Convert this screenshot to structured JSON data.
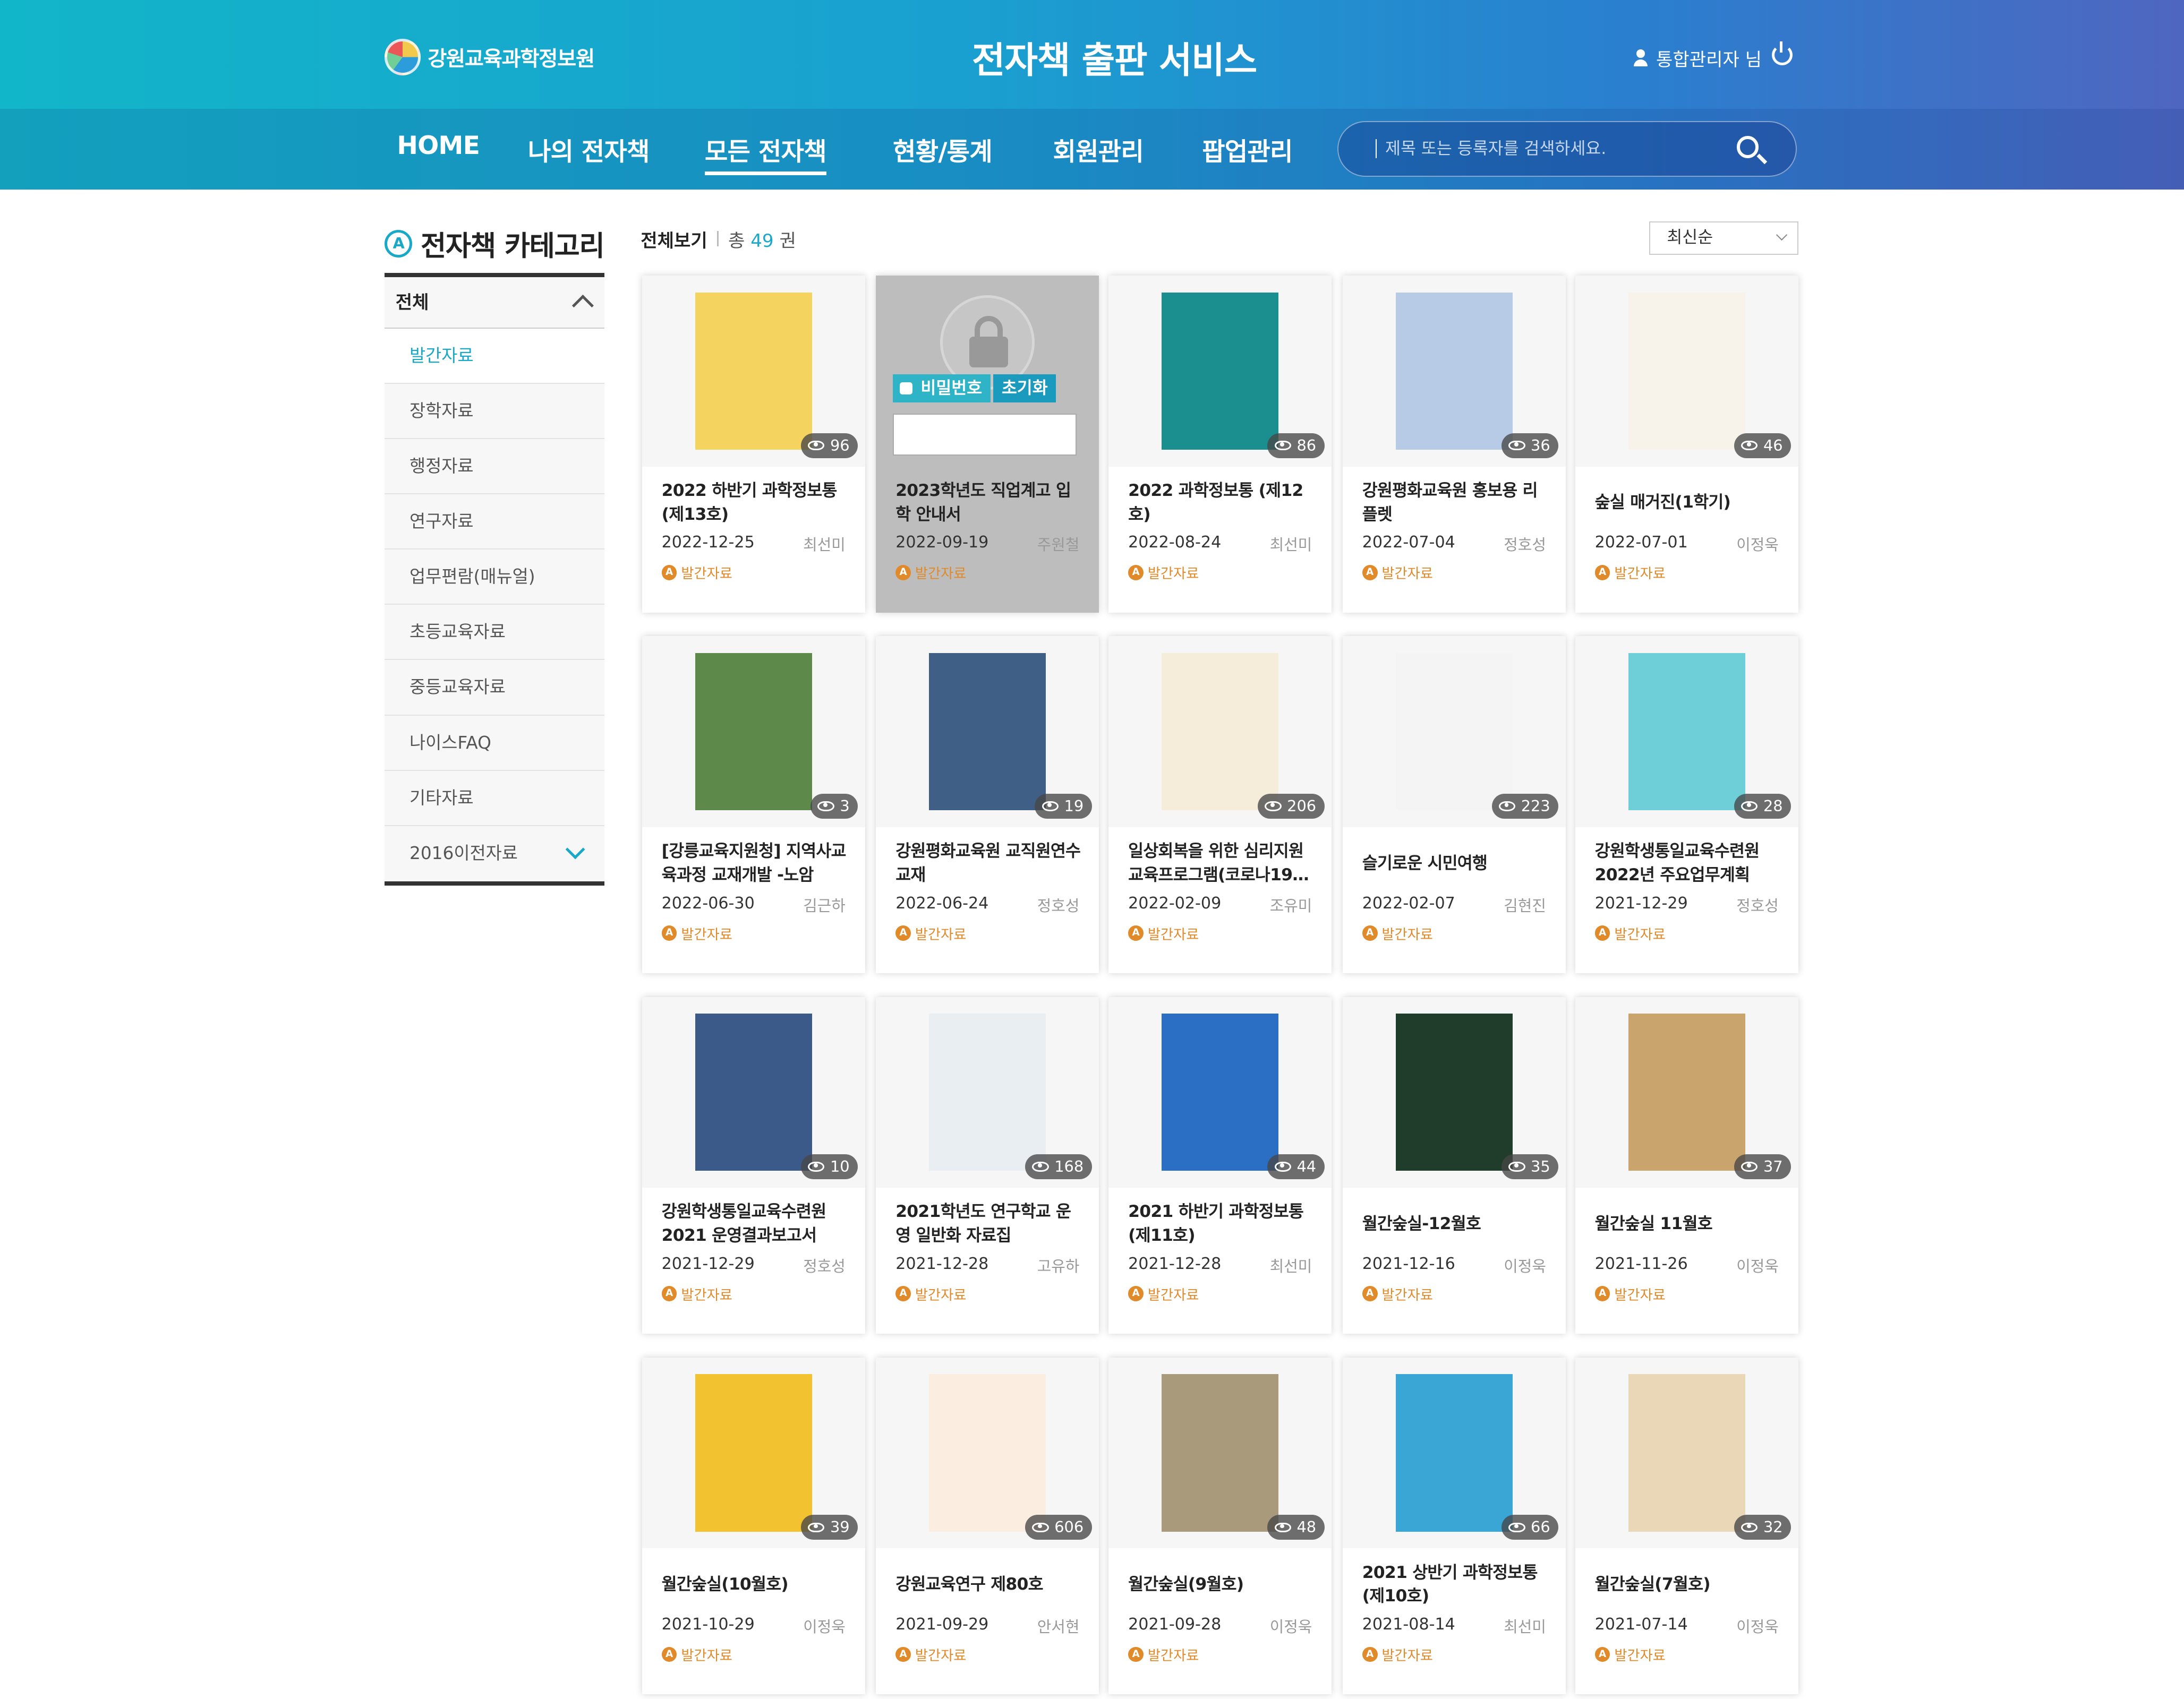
{
  "header": {
    "org_name": "강원교육과학정보원",
    "service_title": "전자책 출판 서비스",
    "user_label": "통합관리자 님"
  },
  "nav": {
    "items": [
      "HOME",
      "나의 전자책",
      "모든 전자책",
      "현황/통계",
      "회원관리",
      "팝업관리"
    ],
    "active": "모든 전자책"
  },
  "search": {
    "placeholder": "제목 또는 등록자를 검색하세요."
  },
  "sidebar": {
    "title": "전자책 카테고리",
    "badge": "A",
    "all_label": "전체",
    "items": [
      "발간자료",
      "장학자료",
      "행정자료",
      "연구자료",
      "업무편람(매뉴얼)",
      "초등교육자료",
      "중등교육자료",
      "나이스FAQ",
      "기타자료",
      "2016이전자료"
    ]
  },
  "list_header": {
    "view_all": "전체보기",
    "total_prefix": "총",
    "total_count": "49",
    "total_suffix": "권"
  },
  "sort": {
    "selected": "최신순"
  },
  "lock_panel": {
    "password_label": "비밀번호",
    "reset_label": "초기화"
  },
  "books": [
    {
      "title": "2022 하반기 과학정보통 (제13호)",
      "date": "2022-12-25",
      "author": "최선미",
      "category": "발간자료",
      "views": "96",
      "cover": "#f4d35e"
    },
    {
      "title": "2023학년도 직업계고 입학 안내서",
      "date": "2022-09-19",
      "author": "주원철",
      "category": "발간자료",
      "views": "",
      "locked": true
    },
    {
      "title": "2022 과학정보통 (제12호)",
      "date": "2022-08-24",
      "author": "최선미",
      "category": "발간자료",
      "views": "86",
      "cover": "#1b8e8f"
    },
    {
      "title": "강원평화교육원 홍보용 리플렛",
      "date": "2022-07-04",
      "author": "정호성",
      "category": "발간자료",
      "views": "36",
      "cover": "#b7cbe6"
    },
    {
      "title": "숲실 매거진(1학기)",
      "date": "2022-07-01",
      "author": "이정욱",
      "category": "발간자료",
      "views": "46",
      "cover": "#f7f3ea"
    },
    {
      "title": "[강릉교육지원청] 지역사교육과정 교재개발 -노암",
      "date": "2022-06-30",
      "author": "김근하",
      "category": "발간자료",
      "views": "3",
      "cover": "#5d8a4a"
    },
    {
      "title": "강원평화교육원 교직원연수 교재",
      "date": "2022-06-24",
      "author": "정호성",
      "category": "발간자료",
      "views": "19",
      "cover": "#3f5f86"
    },
    {
      "title": "일상회복을 위한 심리지원 교육프로그램(코로나19…",
      "date": "2022-02-09",
      "author": "조유미",
      "category": "발간자료",
      "views": "206",
      "cover": "#f5ecd9"
    },
    {
      "title": "슬기로운 시민여행",
      "date": "2022-02-07",
      "author": "김현진",
      "category": "발간자료",
      "views": "223",
      "cover": "#f4f4f4"
    },
    {
      "title": "강원학생통일교육수련원 2022년 주요업무계획",
      "date": "2021-12-29",
      "author": "정호성",
      "category": "발간자료",
      "views": "28",
      "cover": "#6fcfd9"
    },
    {
      "title": "강원학생통일교육수련원 2021 운영결과보고서",
      "date": "2021-12-29",
      "author": "정호성",
      "category": "발간자료",
      "views": "10",
      "cover": "#3b5a8a"
    },
    {
      "title": "2021학년도 연구학교 운영 일반화 자료집",
      "date": "2021-12-28",
      "author": "고유하",
      "category": "발간자료",
      "views": "168",
      "cover": "#e8eef2"
    },
    {
      "title": "2021 하반기 과학정보통 (제11호)",
      "date": "2021-12-28",
      "author": "최선미",
      "category": "발간자료",
      "views": "44",
      "cover": "#2a6fc4"
    },
    {
      "title": "월간숲실-12월호",
      "date": "2021-12-16",
      "author": "이정욱",
      "category": "발간자료",
      "views": "35",
      "cover": "#1f3d2a"
    },
    {
      "title": "월간숲실 11월호",
      "date": "2021-11-26",
      "author": "이정욱",
      "category": "발간자료",
      "views": "37",
      "cover": "#c9a46c"
    },
    {
      "title": "월간숲실(10월호)",
      "date": "2021-10-29",
      "author": "이정욱",
      "category": "발간자료",
      "views": "39",
      "cover": "#f2c230"
    },
    {
      "title": "강원교육연구 제80호",
      "date": "2021-09-29",
      "author": "안서현",
      "category": "발간자료",
      "views": "606",
      "cover": "#fbeee0"
    },
    {
      "title": "월간숲실(9월호)",
      "date": "2021-09-28",
      "author": "이정욱",
      "category": "발간자료",
      "views": "48",
      "cover": "#a89a7a"
    },
    {
      "title": "2021 상반기 과학정보통(제10호)",
      "date": "2021-08-14",
      "author": "최선미",
      "category": "발간자료",
      "views": "66",
      "cover": "#3aa6d6"
    },
    {
      "title": "월간숲실(7월호)",
      "date": "2021-07-14",
      "author": "이정욱",
      "category": "발간자료",
      "views": "32",
      "cover": "#e9d7b8"
    }
  ]
}
